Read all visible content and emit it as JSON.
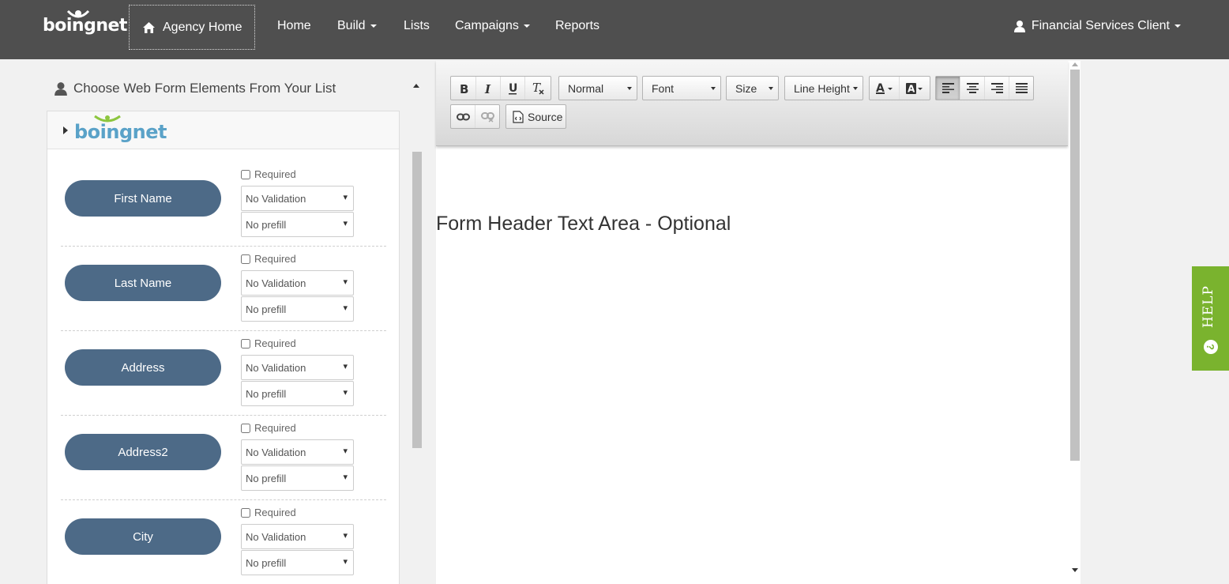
{
  "navbar": {
    "brand": "boingnet",
    "agency_home": "Agency Home",
    "items": [
      {
        "label": "Home",
        "has_caret": false
      },
      {
        "label": "Build",
        "has_caret": true
      },
      {
        "label": "Lists",
        "has_caret": false
      },
      {
        "label": "Campaigns",
        "has_caret": true
      },
      {
        "label": "Reports",
        "has_caret": false
      }
    ],
    "user": "Financial Services Client"
  },
  "left_panel": {
    "heading": "Choose Web Form Elements From Your List",
    "list_logo": "boingnet",
    "fields": [
      {
        "name": "First Name",
        "required_label": "Required",
        "validation": "No Validation",
        "prefill": "No prefill"
      },
      {
        "name": "Last Name",
        "required_label": "Required",
        "validation": "No Validation",
        "prefill": "No prefill"
      },
      {
        "name": "Address",
        "required_label": "Required",
        "validation": "No Validation",
        "prefill": "No prefill"
      },
      {
        "name": "Address2",
        "required_label": "Required",
        "validation": "No Validation",
        "prefill": "No prefill"
      },
      {
        "name": "City",
        "required_label": "Required",
        "validation": "No Validation",
        "prefill": "No prefill"
      }
    ]
  },
  "editor": {
    "toolbar": {
      "format": "Normal",
      "font": "Font",
      "size": "Size",
      "line_height": "Line Height",
      "source": "Source"
    },
    "content": "Form Header Text Area - Optional"
  },
  "help": {
    "label": "HELP",
    "icon": "?"
  },
  "colors": {
    "navbar": "#4f4f4f",
    "field_pill": "#4d6a87",
    "help": "#7ab32e"
  }
}
